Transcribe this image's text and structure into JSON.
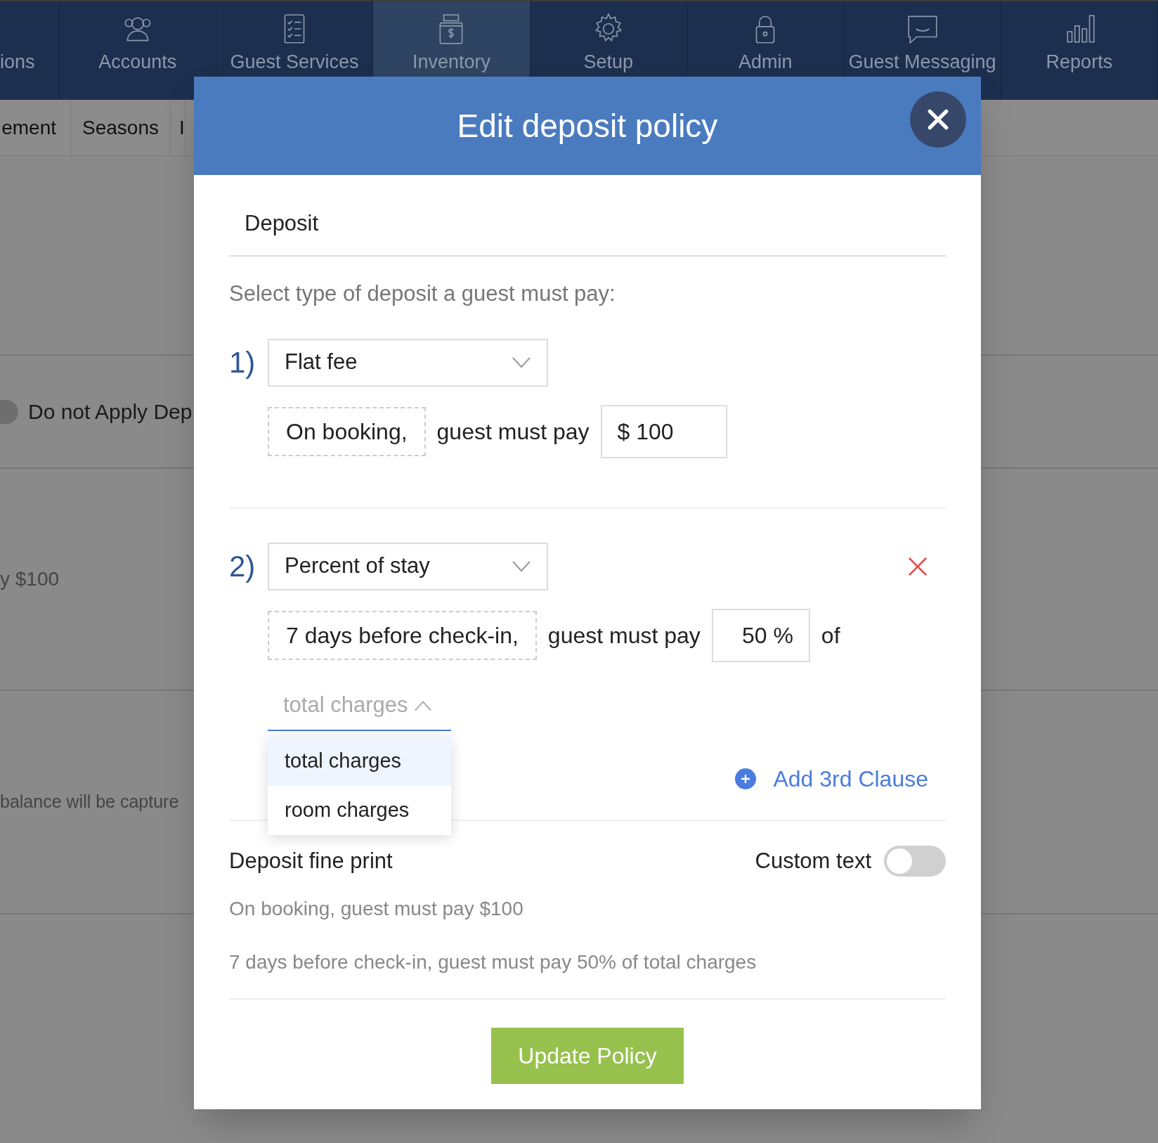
{
  "nav_items": [
    {
      "label": "ions",
      "selected": false
    },
    {
      "label": "Accounts",
      "selected": false
    },
    {
      "label": "Guest Services",
      "selected": false
    },
    {
      "label": "Inventory",
      "selected": true
    },
    {
      "label": "Setup",
      "selected": false
    },
    {
      "label": "Admin",
      "selected": false
    },
    {
      "label": "Guest Messaging",
      "selected": false
    },
    {
      "label": "Reports",
      "selected": false
    }
  ],
  "sub_tabs": [
    "ement",
    "Seasons",
    "I"
  ],
  "background": {
    "toggle_on": false,
    "toggle_label": "Do not Apply Dep",
    "amount_text": "y $100",
    "balance_text": "balance will be capture"
  },
  "modal": {
    "title": "Edit deposit policy",
    "section_tab": "Deposit",
    "prompt": "Select type of deposit a guest must pay:",
    "clauses": [
      {
        "number": "1)",
        "type": "Flat fee",
        "timing": "On booking,",
        "label": "guest must pay",
        "amount": "$ 100",
        "removable": false
      },
      {
        "number": "2)",
        "type": "Percent of stay",
        "timing": "7 days before check-in,",
        "label": "guest must pay",
        "amount": "50 %",
        "suffix": "of",
        "removable": true,
        "basis": {
          "value": "total charges",
          "expanded": true,
          "options": [
            {
              "label": "total charges",
              "selected": true
            },
            {
              "label": "room charges",
              "selected": false
            }
          ]
        }
      }
    ],
    "add_clause": "Add 3rd Clause",
    "fine_print": {
      "title": "Deposit fine print",
      "custom_text_label": "Custom text",
      "custom_text_on": false,
      "lines": [
        "On booking, guest must pay $100",
        "7 days before check-in, guest must pay 50% of total charges"
      ]
    },
    "submit": "Update Policy"
  }
}
